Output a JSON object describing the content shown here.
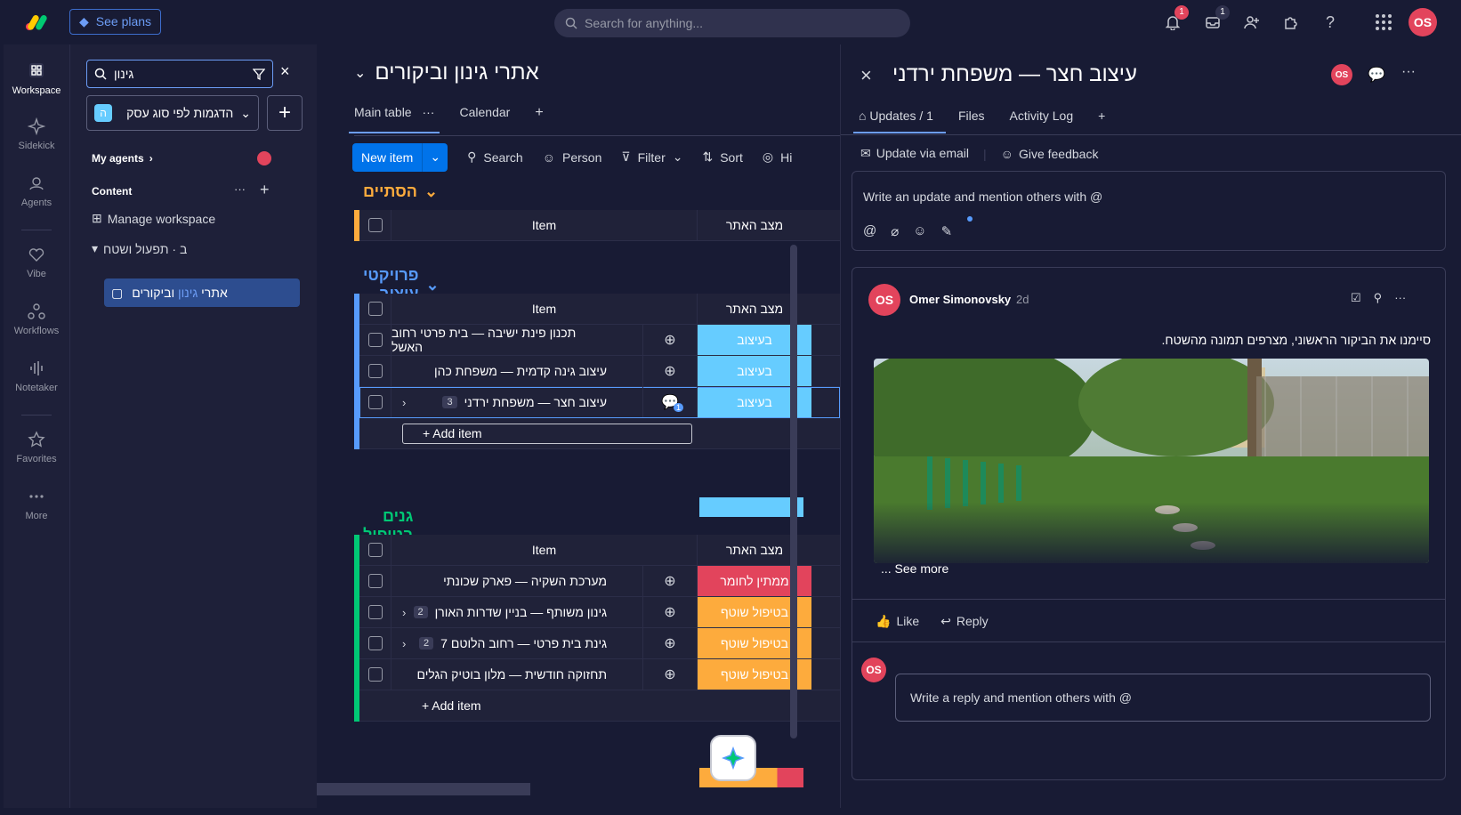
{
  "topbar": {
    "plans_label": "See plans",
    "search_placeholder": "Search for anything...",
    "notif_count": "1",
    "inbox_count": "1",
    "user_initials": "OS"
  },
  "leftnav": {
    "items": [
      {
        "label": "Workspace",
        "icon": "grid-icon"
      },
      {
        "label": "Sidekick",
        "icon": "sparkle-icon"
      },
      {
        "label": "Agents",
        "icon": "agent-icon"
      },
      {
        "label": "Vibe",
        "icon": "heart-icon"
      },
      {
        "label": "Workflows",
        "icon": "workflow-icon"
      },
      {
        "label": "Notetaker",
        "icon": "waveform-icon"
      },
      {
        "label": "Favorites",
        "icon": "star-icon"
      },
      {
        "label": "More",
        "icon": "more-icon"
      }
    ]
  },
  "workspace": {
    "search_value": "גינון",
    "selector_label": "הדגמות לפי סוג עסק",
    "selector_badge": "ה",
    "my_agents": "My agents",
    "content": "Content",
    "manage": "Manage workspace",
    "folder": "ב · תפעול ושטח",
    "board_pre": "אתרי",
    "board_hl": "גינון",
    "board_post": "וביקורים"
  },
  "board": {
    "title": "אתרי גינון וביקורים",
    "tabs": [
      "Main table",
      "Calendar"
    ],
    "toolbar": {
      "new_item": "New item",
      "search": "Search",
      "person": "Person",
      "filter": "Filter",
      "sort": "Sort",
      "hide": "Hi"
    },
    "col_item": "Item",
    "col_status": "מצב האתר",
    "add_item": "+ Add item",
    "groups": [
      {
        "title": "הסתיים",
        "color": "#fdab3d",
        "rows": []
      },
      {
        "title": "פרויקטי עיצוב",
        "color": "#579bfc",
        "rows": [
          {
            "name": "תכנון פינת ישיבה — בית פרטי רחוב האשל",
            "status": "בעיצוב",
            "status_color": "#66ccff",
            "sub": ""
          },
          {
            "name": "עיצוב גינה קדמית — משפחת כהן",
            "status": "בעיצוב",
            "status_color": "#66ccff",
            "sub": ""
          },
          {
            "name": "עיצוב חצר — משפחת ירדני",
            "status": "בעיצוב",
            "status_color": "#66ccff",
            "sub": "3",
            "updates": "1"
          }
        ]
      },
      {
        "title": "גנים בטיפול שוטף",
        "color": "#00c875",
        "rows": [
          {
            "name": "מערכת השקיה — פארק שכונתי",
            "status": "ממתין לחומר",
            "status_color": "#e2445c",
            "sub": ""
          },
          {
            "name": "גינון משותף — בניין שדרות האורן",
            "status": "בטיפול שוטף",
            "status_color": "#fdab3d",
            "sub": "2"
          },
          {
            "name": "גינת בית פרטי — רחוב הלוטם 7",
            "status": "בטיפול שוטף",
            "status_color": "#fdab3d",
            "sub": "2"
          },
          {
            "name": "תחזוקה חודשית — מלון בוטיק הגלים",
            "status": "בטיפול שוטף",
            "status_color": "#fdab3d",
            "sub": ""
          }
        ]
      }
    ]
  },
  "panel": {
    "title": "עיצוב חצר — משפחת ירדני",
    "tabs": [
      "Updates / 1",
      "Files",
      "Activity Log"
    ],
    "update_email": "Update via email",
    "feedback": "Give feedback",
    "editor_placeholder": "Write an update and mention others with @",
    "post": {
      "author": "Omer Simonovsky",
      "time": "2d",
      "text": "סיימנו את הביקור הראשוני, מצרפים תמונה מהשטח.",
      "see_more": "... See more",
      "like": "Like",
      "reply": "Reply"
    },
    "reply_placeholder": "Write a reply and mention others with @"
  }
}
